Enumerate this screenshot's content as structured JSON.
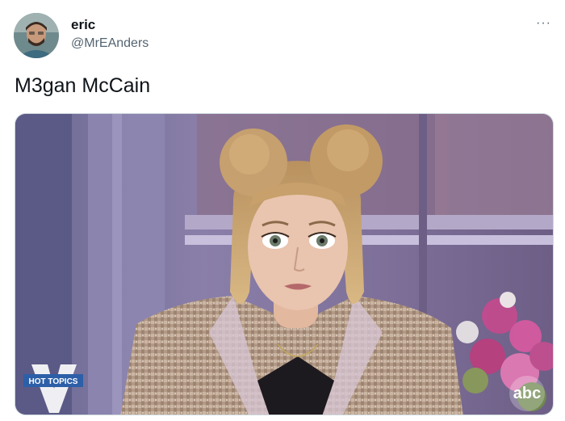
{
  "author": {
    "display_name": "eric",
    "handle": "@MrEAnders"
  },
  "tweet": {
    "text": "M3gan McCain",
    "more_label": "···"
  },
  "media": {
    "show_badge_text": "HOT TOPICS",
    "network_logo_text": "abc"
  },
  "icons": {
    "avatar": "person-avatar",
    "more": "more-horizontal-icon"
  }
}
